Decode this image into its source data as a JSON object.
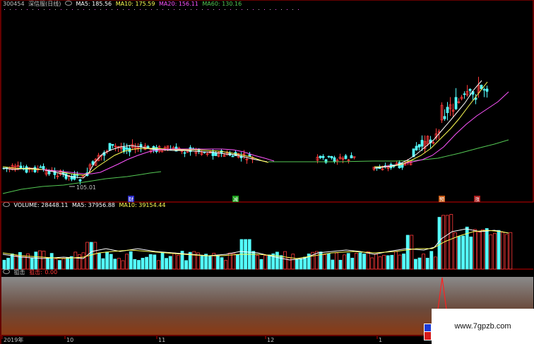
{
  "price_panel": {
    "code": "300454",
    "name": "深信服(日线)",
    "ma5": "MA5: 185.56",
    "ma10": "MA10: 175.59",
    "ma20": "MA20: 156.11",
    "ma60": "MA60: 130.16",
    "low_marker": "105.01",
    "event_tags": [
      "财",
      "减",
      "预",
      "涨"
    ]
  },
  "volume_panel": {
    "volume": "VOLUME: 28448.11",
    "ma5": "MA5: 37956.88",
    "ma10": "MA10: 39154.44"
  },
  "indicator_panel": {
    "name": "狙击",
    "label": "狙击:",
    "value": "0.00"
  },
  "time_axis": {
    "labels": [
      "2019年",
      "10",
      "11",
      "12",
      "1"
    ]
  },
  "watermark": "www.7gpzb.com",
  "colors": {
    "up": "#ff3a3a",
    "down": "#54fcfc",
    "ma5": "#ffffff",
    "ma10": "#ffff54",
    "ma20": "#ff54ff",
    "ma60": "#54c854",
    "panel_border": "#c80000"
  },
  "chart_data": {
    "type": "candlestick",
    "title": "300454 深信服(日线)",
    "series": [
      {
        "name": "MA5",
        "values": [
          185.56
        ]
      },
      {
        "name": "MA10",
        "values": [
          175.59
        ]
      },
      {
        "name": "MA20",
        "values": [
          156.11
        ]
      },
      {
        "name": "MA60",
        "values": [
          130.16
        ]
      }
    ],
    "x_labels": [
      "2019年",
      "10",
      "11",
      "12",
      "1"
    ],
    "annotation": "105.01"
  }
}
